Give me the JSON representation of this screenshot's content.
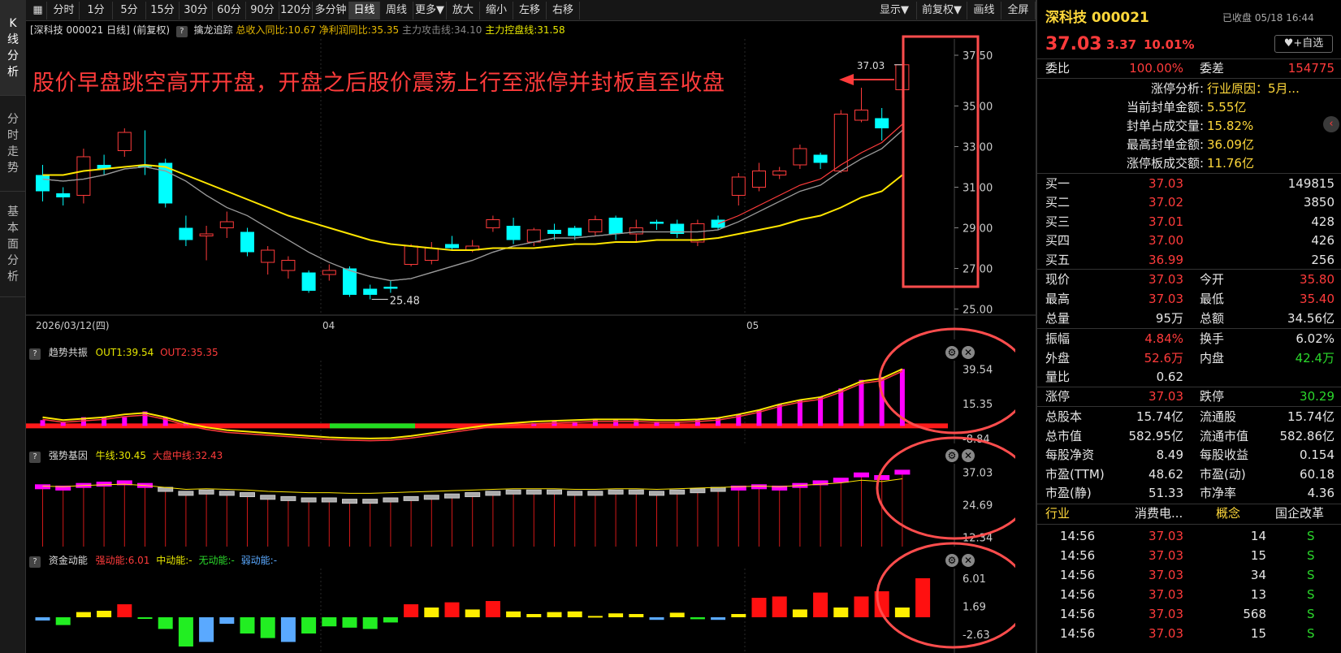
{
  "nav": {
    "left_tabs": [
      {
        "label": "K线分析",
        "chars": [
          "K",
          "线",
          "分",
          "析"
        ]
      },
      {
        "label": "分时走势",
        "chars": [
          "分",
          "时",
          "走",
          "势"
        ]
      },
      {
        "label": "基本面分析",
        "chars": [
          "基",
          "本",
          "面",
          "分",
          "析"
        ]
      }
    ]
  },
  "toolbar": {
    "periods": [
      "分时",
      "1分",
      "5分",
      "15分",
      "30分",
      "60分",
      "90分",
      "120分",
      "多分钟",
      "日线",
      "周线",
      "更多▼",
      "放大",
      "缩小",
      "左移",
      "右移"
    ],
    "active_period": "日线",
    "right_buttons": [
      "显示▼",
      "前复权▼",
      "画线",
      "全屏"
    ]
  },
  "info": {
    "stock_tag": "[深科技 000021 日线]",
    "adjust": "(前复权)",
    "indicator_name": "擒龙追踪",
    "revenue_label": "总收入同比:10.67",
    "profit_label": "净利润同比:35.35",
    "attack_label": "主力攻击线:34.10",
    "control_label": "主力控盘线:31.58"
  },
  "annotation": {
    "text": "股价早盘跳空高开开盘，开盘之后股价震荡上行至涨停并封板直至收盘",
    "color": "#ff3b3b"
  },
  "main_chart": {
    "price_labels": [
      "37.50",
      "35.00",
      "33.00",
      "31.00",
      "29.00",
      "27.00",
      "25.00"
    ],
    "high_label": "37.03",
    "low_label": "25.48",
    "date_labels": [
      "2026/03/12(四)",
      "04",
      "05"
    ]
  },
  "panels": {
    "trend": {
      "name": "趋势共振",
      "out1": "OUT1:39.54",
      "out2": "OUT2:35.35",
      "ticks": [
        "39.54",
        "15.35",
        "-8.84"
      ]
    },
    "gene": {
      "name": "强势基因",
      "bull": "牛线:30.45",
      "mid": "大盘中线:32.43",
      "ticks": [
        "37.03",
        "24.69",
        "12.34"
      ]
    },
    "fund": {
      "name": "资金动能",
      "strong": "强动能:6.01",
      "medium": "中动能:-",
      "none": "无动能:-",
      "weak": "弱动能:-",
      "ticks": [
        "6.01",
        "1.69",
        "-2.63"
      ]
    }
  },
  "chart_data": {
    "type": "candlestick",
    "title": "深科技 000021 日线",
    "candles": [
      {
        "o": 31.6,
        "c": 30.8,
        "h": 32.1,
        "l": 30.3
      },
      {
        "o": 30.7,
        "c": 30.5,
        "h": 31.0,
        "l": 30.1
      },
      {
        "o": 30.6,
        "c": 32.5,
        "h": 32.9,
        "l": 30.2
      },
      {
        "o": 32.1,
        "c": 31.9,
        "h": 32.6,
        "l": 31.6
      },
      {
        "o": 32.8,
        "c": 33.7,
        "h": 33.9,
        "l": 32.5
      },
      {
        "o": 32.1,
        "c": 32.0,
        "h": 33.8,
        "l": 31.6
      },
      {
        "o": 32.2,
        "c": 30.2,
        "h": 32.4,
        "l": 30.0
      },
      {
        "o": 29.0,
        "c": 28.4,
        "h": 29.6,
        "l": 28.1
      },
      {
        "o": 28.6,
        "c": 28.7,
        "h": 29.1,
        "l": 27.4
      },
      {
        "o": 29.0,
        "c": 29.3,
        "h": 29.8,
        "l": 28.5
      },
      {
        "o": 28.8,
        "c": 27.8,
        "h": 29.0,
        "l": 27.6
      },
      {
        "o": 27.3,
        "c": 27.9,
        "h": 28.1,
        "l": 26.7
      },
      {
        "o": 26.9,
        "c": 27.4,
        "h": 27.6,
        "l": 26.5
      },
      {
        "o": 26.8,
        "c": 25.9,
        "h": 26.9,
        "l": 25.8
      },
      {
        "o": 26.7,
        "c": 26.9,
        "h": 27.2,
        "l": 26.4
      },
      {
        "o": 27.0,
        "c": 25.7,
        "h": 27.1,
        "l": 25.6
      },
      {
        "o": 26.0,
        "c": 25.7,
        "h": 26.2,
        "l": 25.48
      },
      {
        "o": 26.1,
        "c": 26.0,
        "h": 26.4,
        "l": 25.8
      },
      {
        "o": 27.2,
        "c": 28.1,
        "h": 28.2,
        "l": 27.1
      },
      {
        "o": 27.4,
        "c": 28.0,
        "h": 28.3,
        "l": 27.2
      },
      {
        "o": 28.2,
        "c": 28.0,
        "h": 28.6,
        "l": 27.9
      },
      {
        "o": 27.9,
        "c": 28.1,
        "h": 28.4,
        "l": 27.8
      },
      {
        "o": 29.0,
        "c": 29.4,
        "h": 29.6,
        "l": 28.8
      },
      {
        "o": 29.1,
        "c": 28.4,
        "h": 29.5,
        "l": 28.2
      },
      {
        "o": 28.3,
        "c": 28.9,
        "h": 29.0,
        "l": 28.1
      },
      {
        "o": 28.9,
        "c": 28.7,
        "h": 29.2,
        "l": 28.4
      },
      {
        "o": 29.0,
        "c": 28.6,
        "h": 29.1,
        "l": 28.4
      },
      {
        "o": 28.8,
        "c": 29.4,
        "h": 29.6,
        "l": 28.6
      },
      {
        "o": 29.5,
        "c": 28.7,
        "h": 29.6,
        "l": 28.4
      },
      {
        "o": 28.7,
        "c": 29.0,
        "h": 29.4,
        "l": 28.3
      },
      {
        "o": 29.3,
        "c": 29.2,
        "h": 29.4,
        "l": 28.9
      },
      {
        "o": 29.2,
        "c": 28.7,
        "h": 29.4,
        "l": 28.5
      },
      {
        "o": 28.3,
        "c": 29.2,
        "h": 29.4,
        "l": 28.1
      },
      {
        "o": 29.4,
        "c": 29.0,
        "h": 29.6,
        "l": 28.9
      },
      {
        "o": 30.6,
        "c": 31.5,
        "h": 31.7,
        "l": 30.1
      },
      {
        "o": 31.0,
        "c": 31.8,
        "h": 32.2,
        "l": 30.8
      },
      {
        "o": 31.6,
        "c": 31.8,
        "h": 32.0,
        "l": 31.4
      },
      {
        "o": 32.1,
        "c": 32.9,
        "h": 33.1,
        "l": 31.9
      },
      {
        "o": 32.6,
        "c": 32.2,
        "h": 32.7,
        "l": 31.9
      },
      {
        "o": 31.8,
        "c": 34.6,
        "h": 34.8,
        "l": 31.7
      },
      {
        "o": 34.3,
        "c": 34.8,
        "h": 35.9,
        "l": 34.2
      },
      {
        "o": 34.4,
        "c": 33.9,
        "h": 34.9,
        "l": 33.3
      },
      {
        "o": 35.8,
        "c": 37.03,
        "h": 37.03,
        "l": 35.4
      }
    ],
    "ma_attack": [
      31.4,
      31.3,
      31.4,
      31.6,
      31.9,
      32.0,
      31.8,
      31.3,
      30.6,
      30.0,
      29.6,
      29.0,
      28.4,
      27.8,
      27.3,
      26.9,
      26.6,
      26.4,
      26.5,
      26.8,
      27.1,
      27.4,
      27.8,
      28.1,
      28.3,
      28.5,
      28.5,
      28.6,
      28.7,
      28.8,
      28.8,
      28.8,
      28.8,
      28.9,
      29.3,
      29.8,
      30.3,
      30.8,
      31.1,
      31.8,
      32.4,
      32.9,
      33.8
    ],
    "ma_control": [
      31.6,
      31.6,
      31.8,
      31.9,
      32.0,
      32.1,
      32.0,
      31.6,
      31.2,
      30.8,
      30.4,
      30.0,
      29.6,
      29.3,
      29.0,
      28.7,
      28.4,
      28.2,
      28.1,
      28.0,
      27.9,
      27.9,
      28.0,
      28.0,
      28.0,
      28.1,
      28.2,
      28.2,
      28.3,
      28.3,
      28.4,
      28.4,
      28.4,
      28.5,
      28.7,
      28.9,
      29.1,
      29.4,
      29.6,
      30.0,
      30.5,
      30.8,
      31.6
    ],
    "trend_bars": [
      4,
      3,
      6,
      6,
      6,
      10,
      6,
      2,
      0,
      0,
      0,
      0,
      0,
      0,
      0,
      0,
      0,
      0,
      0,
      0,
      0,
      0,
      0,
      0,
      2,
      3,
      3,
      4,
      4,
      4,
      3,
      3,
      4,
      5,
      8,
      11,
      15,
      18,
      20,
      26,
      32,
      34,
      39.54
    ],
    "gene_bars": [
      31.5,
      31.0,
      32.0,
      32.5,
      33.0,
      32.0,
      30.5,
      29.0,
      29.5,
      29.0,
      28.5,
      27.5,
      27.0,
      26.5,
      26.5,
      26.0,
      26.0,
      26.5,
      27.0,
      27.5,
      28.0,
      28.5,
      29.0,
      29.5,
      29.5,
      29.5,
      29.0,
      29.0,
      29.5,
      29.5,
      29.0,
      29.5,
      30.0,
      30.5,
      31.0,
      31.5,
      31.0,
      32.0,
      33.0,
      34.0,
      36.0,
      35.0,
      37.03
    ],
    "fund_bars": [
      -0.5,
      -1.2,
      0.8,
      1.0,
      2.0,
      -0.2,
      -1.8,
      -4.5,
      -3.8,
      -1.0,
      -2.5,
      -3.2,
      -3.8,
      -2.5,
      -1.4,
      -1.6,
      -1.8,
      -0.8,
      2.0,
      1.5,
      2.3,
      1.2,
      2.5,
      0.9,
      0.5,
      0.8,
      0.9,
      0.2,
      0.6,
      0.5,
      -0.4,
      0.7,
      -0.3,
      -0.4,
      0.5,
      3.0,
      3.2,
      1.2,
      3.8,
      1.5,
      3.2,
      4.0,
      1.5,
      6.01
    ]
  },
  "quote": {
    "name": "深科技 000021",
    "status": "已收盘 05/18 16:44",
    "price": "37.03",
    "change": "3.37",
    "pct": "10.01%",
    "watch_button": "+自选",
    "weibi_label": "委比",
    "weibi": "100.00%",
    "weicha_label": "委差",
    "weicha": "154775",
    "limit_analysis": [
      {
        "k": "涨停分析:",
        "v": "行业原因：5月..."
      },
      {
        "k": "当前封单金额:",
        "v": "5.55亿"
      },
      {
        "k": "封单占成交量:",
        "v": "15.82%"
      },
      {
        "k": "最高封单金额:",
        "v": "36.09亿"
      },
      {
        "k": "涨停板成交额:",
        "v": "11.76亿"
      }
    ],
    "bids": [
      {
        "k": "买一",
        "p": "37.03",
        "v": "149815"
      },
      {
        "k": "买二",
        "p": "37.02",
        "v": "3850"
      },
      {
        "k": "买三",
        "p": "37.01",
        "v": "428"
      },
      {
        "k": "买四",
        "p": "37.00",
        "v": "426"
      },
      {
        "k": "买五",
        "p": "36.99",
        "v": "256"
      }
    ],
    "stats": [
      {
        "k1": "现价",
        "v1": "37.03",
        "c1": "red",
        "k2": "今开",
        "v2": "35.80",
        "c2": "red"
      },
      {
        "k1": "最高",
        "v1": "37.03",
        "c1": "red",
        "k2": "最低",
        "v2": "35.40",
        "c2": "red"
      },
      {
        "k1": "总量",
        "v1": "95万",
        "c1": "white",
        "k2": "总额",
        "v2": "34.56亿",
        "c2": "white"
      }
    ],
    "stats2": [
      {
        "k1": "振幅",
        "v1": "4.84%",
        "c1": "red",
        "k2": "换手",
        "v2": "6.02%",
        "c2": "white"
      },
      {
        "k1": "外盘",
        "v1": "52.6万",
        "c1": "red",
        "k2": "内盘",
        "v2": "42.4万",
        "c2": "green"
      },
      {
        "k1": "量比",
        "v1": "0.62",
        "c1": "white",
        "k2": "",
        "v2": "",
        "c2": "white"
      }
    ],
    "limits": {
      "k1": "涨停",
      "v1": "37.03",
      "k2": "跌停",
      "v2": "30.29"
    },
    "fundamentals": [
      {
        "k1": "总股本",
        "v1": "15.74亿",
        "k2": "流通股",
        "v2": "15.74亿"
      },
      {
        "k1": "总市值",
        "v1": "582.95亿",
        "k2": "流通市值",
        "v2": "582.86亿"
      },
      {
        "k1": "每股净资",
        "v1": "8.49",
        "k2": "每股收益",
        "v2": "0.154"
      },
      {
        "k1": "市盈(TTM)",
        "v1": "48.62",
        "k2": "市盈(动)",
        "v2": "60.18"
      },
      {
        "k1": "市盈(静)",
        "v1": "51.33",
        "k2": "市净率",
        "v2": "4.36"
      }
    ],
    "tags": {
      "industry_label": "行业",
      "industry": "消费电...",
      "concept_label": "概念",
      "concept": "国企改革"
    },
    "ticks": [
      {
        "t": "14:56",
        "p": "37.03",
        "v": "14",
        "s": "S"
      },
      {
        "t": "14:56",
        "p": "37.03",
        "v": "15",
        "s": "S"
      },
      {
        "t": "14:56",
        "p": "37.03",
        "v": "34",
        "s": "S"
      },
      {
        "t": "14:56",
        "p": "37.03",
        "v": "13",
        "s": "S"
      },
      {
        "t": "14:56",
        "p": "37.03",
        "v": "568",
        "s": "S"
      },
      {
        "t": "14:56",
        "p": "37.03",
        "v": "15",
        "s": "S"
      }
    ]
  }
}
